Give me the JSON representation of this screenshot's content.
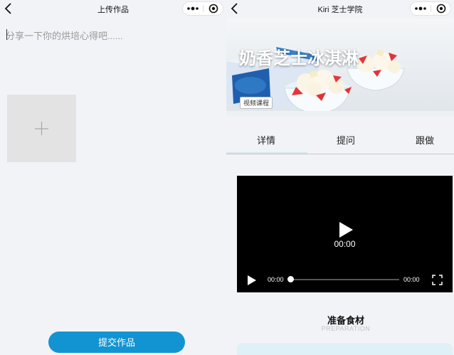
{
  "left": {
    "nav_title": "上传作品",
    "share_placeholder": "分享一下你的烘培心得吧......",
    "submit_label": "提交作品"
  },
  "right": {
    "nav_title": "Kiri 芝士学院",
    "banner": {
      "title": "奶香芝士冰淇淋",
      "badge": "视频课程"
    },
    "tabs": [
      {
        "label": "详情",
        "active": true
      },
      {
        "label": "提问",
        "active": false
      },
      {
        "label": "跟做",
        "active": false
      }
    ],
    "video": {
      "center_time": "00:00",
      "current_time": "00:00",
      "duration": "00:00",
      "progress": 0
    },
    "section": {
      "title": "准备食材",
      "subtitle": "PREPARATION"
    }
  },
  "icons": {
    "back": "chevron-left-icon",
    "more": "more-dots-icon",
    "close": "target-close-icon",
    "add": "plus-icon",
    "play": "play-icon",
    "fullscreen": "fullscreen-icon"
  },
  "colors": {
    "page_bg": "#f2f3f7",
    "submit_button": "#1294d3",
    "tab_indicator": "#cfe7f2",
    "video_bg": "#000000",
    "bottom_card": "#dff1f6"
  }
}
